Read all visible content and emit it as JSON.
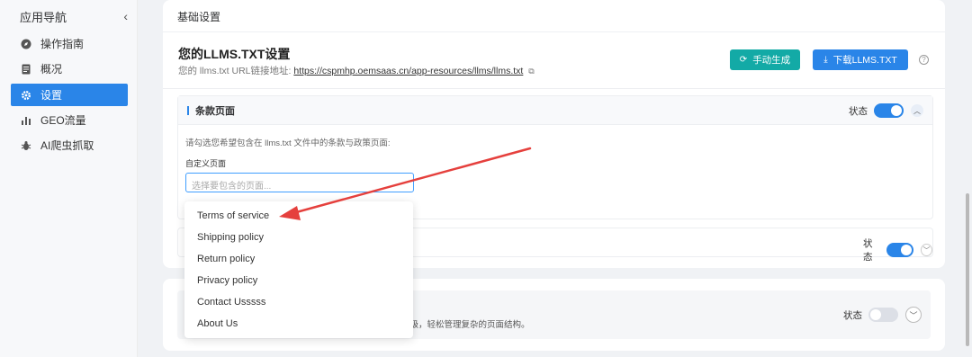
{
  "sidebar": {
    "title": "应用导航",
    "collapse_icon": "chevron-left-icon",
    "items": [
      {
        "label": "操作指南",
        "icon": "guide-icon",
        "active": false
      },
      {
        "label": "概况",
        "icon": "document-icon",
        "active": false
      },
      {
        "label": "设置",
        "icon": "gear-icon",
        "active": true
      },
      {
        "label": "GEO流量",
        "icon": "bar-chart-icon",
        "active": false
      },
      {
        "label": "AI爬虫抓取",
        "icon": "bug-icon",
        "active": false
      }
    ]
  },
  "basic_settings": {
    "title": "基础设置",
    "llms_title": "您的LLMS.TXT设置",
    "llms_sub_label": "您的 llms.txt URL链接地址:",
    "llms_url": "https://cspmhp.oemsaas.cn/app-resources/llms/llms.txt",
    "btn_generate": "手动生成",
    "btn_download": "下载LLMS.TXT"
  },
  "terms_section": {
    "title": "条款页面",
    "status_label": "状态",
    "status_on": true,
    "description": "请勾选您希望包含在 llms.txt 文件中的条款与政策页面:",
    "field_label": "自定义页面",
    "placeholder": "选择要包含的页面..."
  },
  "second_section": {
    "status_label": "状态",
    "status_on": true
  },
  "card2": {
    "description": "层级，轻松管理复杂的页面结构。",
    "status_label": "状态",
    "status_on": false
  },
  "dropdown": {
    "options": [
      "Terms of service",
      "Shipping policy",
      "Return policy",
      "Privacy policy",
      "Contact Usssss",
      "About Us"
    ]
  },
  "colors": {
    "primary": "#2a85e8",
    "teal": "#13aaa6",
    "annotation_arrow": "#e5403d"
  }
}
